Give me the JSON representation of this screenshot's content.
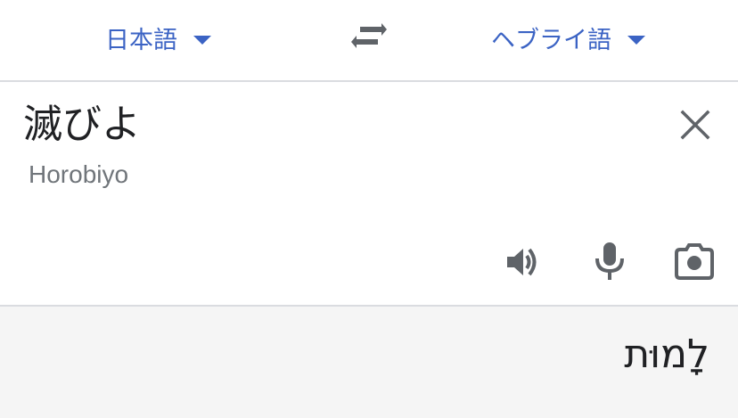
{
  "language_bar": {
    "source_language": "日本語",
    "target_language": "ヘブライ語",
    "swap_icon": "swap-arrows-icon"
  },
  "input": {
    "source_text": "滅びよ",
    "romanization": "Horobiyo",
    "icons": {
      "clear": "close-icon",
      "speaker": "speaker-icon",
      "mic": "microphone-icon",
      "camera": "camera-icon"
    }
  },
  "output": {
    "translation_text": "לָמוּת"
  },
  "colors": {
    "accent": "#3b63c4",
    "icon": "#5f6368",
    "text": "#202124",
    "secondary_text": "#70757a",
    "output_background": "#f5f5f5",
    "divider": "#dadce0"
  }
}
